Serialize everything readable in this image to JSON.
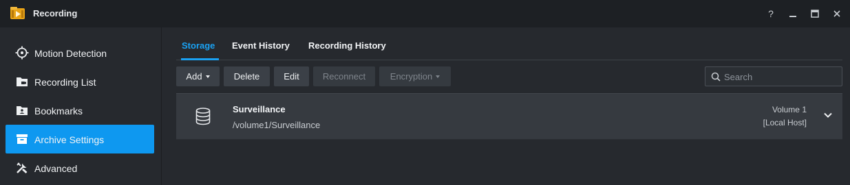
{
  "window": {
    "title": "Recording",
    "controls": [
      "help-icon",
      "minimize-icon",
      "maximize-icon",
      "close-icon"
    ],
    "help_glyph": "?"
  },
  "sidebar": {
    "items": [
      {
        "label": "Motion Detection",
        "icon": "crosshair-icon",
        "active": false
      },
      {
        "label": "Recording List",
        "icon": "folder-video-icon",
        "active": false
      },
      {
        "label": "Bookmarks",
        "icon": "bookmark-folder-icon",
        "active": false
      },
      {
        "label": "Archive Settings",
        "icon": "archive-box-icon",
        "active": true
      },
      {
        "label": "Advanced",
        "icon": "tools-icon",
        "active": false
      }
    ]
  },
  "tabs": [
    {
      "label": "Storage",
      "active": true
    },
    {
      "label": "Event History",
      "active": false
    },
    {
      "label": "Recording History",
      "active": false
    }
  ],
  "toolbar": {
    "add_label": "Add",
    "delete_label": "Delete",
    "edit_label": "Edit",
    "reconnect_label": "Reconnect",
    "encryption_label": "Encryption"
  },
  "search": {
    "placeholder": "Search",
    "value": ""
  },
  "storage": {
    "items": [
      {
        "name": "Surveillance",
        "path": "/volume1/Surveillance",
        "volume": "Volume 1",
        "host": "[Local Host]",
        "icon": "database-icon"
      }
    ]
  },
  "colors": {
    "accent": "#0e98f0",
    "tab_active": "#1aa1f2",
    "background": "#26292e",
    "titlebar": "#1d2024",
    "row": "#363a40"
  }
}
